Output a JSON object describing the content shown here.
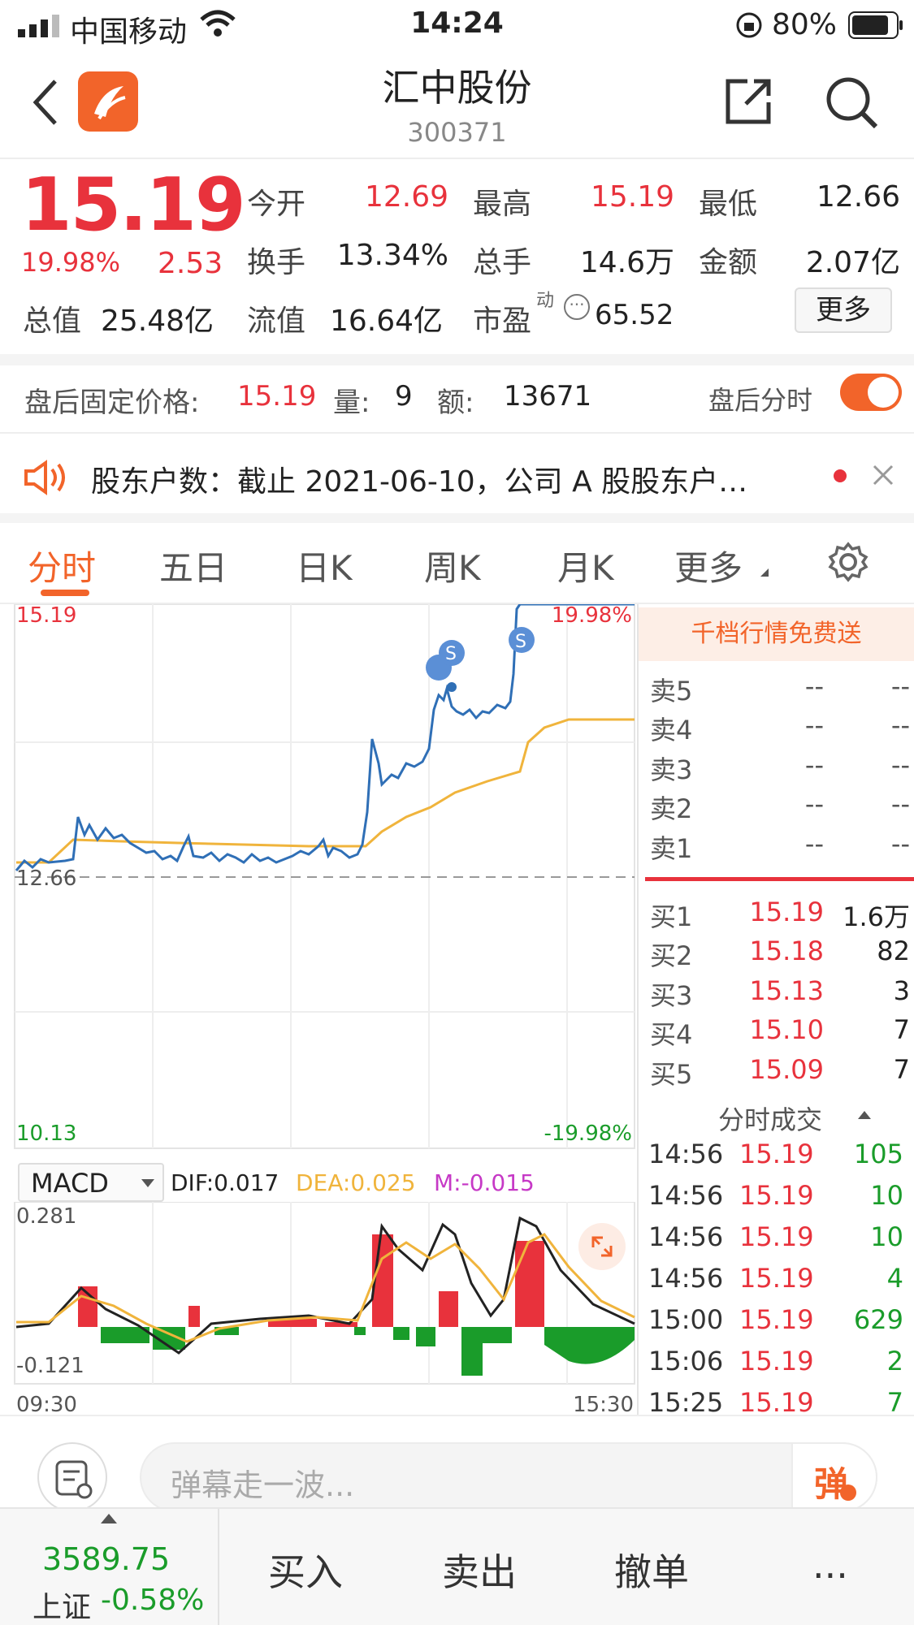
{
  "status_bar": {
    "carrier": "中国移动",
    "time": "14:24",
    "battery": "80%"
  },
  "header": {
    "title": "汇中股份",
    "code": "300371"
  },
  "quote": {
    "price": "15.19",
    "change_pct": "19.98%",
    "change": "2.53",
    "fields": [
      {
        "label": "今开",
        "value": "12.69",
        "color": "red"
      },
      {
        "label": "最高",
        "value": "15.19",
        "color": "red"
      },
      {
        "label": "最低",
        "value": "12.66",
        "color": "black"
      },
      {
        "label": "换手",
        "value": "13.34%",
        "color": "black"
      },
      {
        "label": "总手",
        "value": "14.6万",
        "color": "black"
      },
      {
        "label": "金额",
        "value": "2.07亿",
        "color": "black"
      }
    ],
    "total_value_label": "总值",
    "total_value": "25.48亿",
    "float_value_label": "流值",
    "float_value": "16.64亿",
    "pe_label": "市盈",
    "pe_sup": "动",
    "pe_value": "65.52",
    "more_label": "更多"
  },
  "after_hours": {
    "price_label": "盘后固定价格:",
    "price": "15.19",
    "vol_label": "量:",
    "vol": "9",
    "amount_label": "额:",
    "amount": "13671",
    "toggle_label": "盘后分时",
    "toggle_on": true
  },
  "notice": {
    "text": "股东户数：截止 2021-06-10，公司 A 股股东户…"
  },
  "tabs": {
    "items": [
      "分时",
      "五日",
      "日K",
      "周K",
      "月K",
      "更多"
    ],
    "active": 0
  },
  "chart": {
    "top_left": "15.19",
    "top_right": "19.98%",
    "mid_left": "12.66",
    "bottom_left": "10.13",
    "bottom_right": "-19.98%",
    "time_start": "09:30",
    "time_end": "15:30"
  },
  "macd": {
    "selector": "MACD",
    "dif": "DIF:0.017",
    "dea": "DEA:0.025",
    "m": "M:-0.015",
    "top": "0.281",
    "bottom": "-0.121"
  },
  "orderbook": {
    "banner": "千档行情免费送",
    "asks": [
      {
        "label": "卖5",
        "price": "--",
        "vol": "--"
      },
      {
        "label": "卖4",
        "price": "--",
        "vol": "--"
      },
      {
        "label": "卖3",
        "price": "--",
        "vol": "--"
      },
      {
        "label": "卖2",
        "price": "--",
        "vol": "--"
      },
      {
        "label": "卖1",
        "price": "--",
        "vol": "--"
      }
    ],
    "bids": [
      {
        "label": "买1",
        "price": "15.19",
        "vol": "1.6万"
      },
      {
        "label": "买2",
        "price": "15.18",
        "vol": "82"
      },
      {
        "label": "买3",
        "price": "15.13",
        "vol": "3"
      },
      {
        "label": "买4",
        "price": "15.10",
        "vol": "7"
      },
      {
        "label": "买5",
        "price": "15.09",
        "vol": "7"
      }
    ]
  },
  "trades": {
    "title": "分时成交",
    "rows": [
      {
        "time": "14:56",
        "price": "15.19",
        "vol": "105"
      },
      {
        "time": "14:56",
        "price": "15.19",
        "vol": "10"
      },
      {
        "time": "14:56",
        "price": "15.19",
        "vol": "10"
      },
      {
        "time": "14:56",
        "price": "15.19",
        "vol": "4"
      },
      {
        "time": "15:00",
        "price": "15.19",
        "vol": "629"
      },
      {
        "time": "15:06",
        "price": "15.19",
        "vol": "2"
      },
      {
        "time": "15:25",
        "price": "15.19",
        "vol": "7"
      }
    ]
  },
  "danmaku": {
    "placeholder": "弹幕走一波...",
    "button": "弹"
  },
  "bottom_bar": {
    "index_value": "3589.75",
    "index_name": "上证",
    "index_change": "-0.58%",
    "buy": "买入",
    "sell": "卖出",
    "cancel": "撤单",
    "more": "..."
  },
  "colors": {
    "red": "#e8323c",
    "green": "#1a9c2a",
    "orange": "#f2642a",
    "price_line": "#2f6fb6",
    "avg_line": "#f0b43c"
  }
}
